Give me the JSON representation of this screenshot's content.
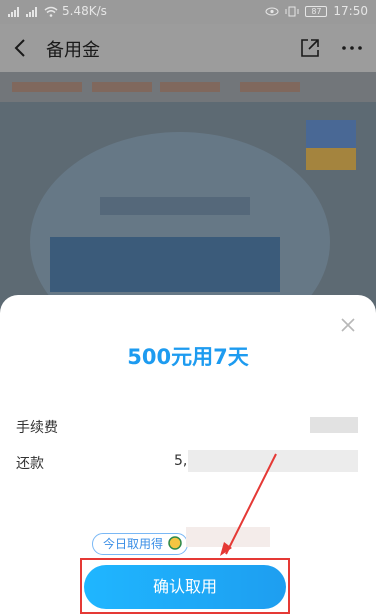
{
  "status_bar": {
    "network_speed": "5.48K/s",
    "battery": "87",
    "time": "17:50"
  },
  "nav": {
    "title": "备用金"
  },
  "sheet": {
    "title": "500元用7天",
    "fee_label": "手续费",
    "repay_label": "还款",
    "repay_value": "5,",
    "promo_text": "今日取用得",
    "confirm_label": "确认取用"
  },
  "colors": {
    "accent": "#1d9bf0",
    "highlight": "#e53935"
  }
}
